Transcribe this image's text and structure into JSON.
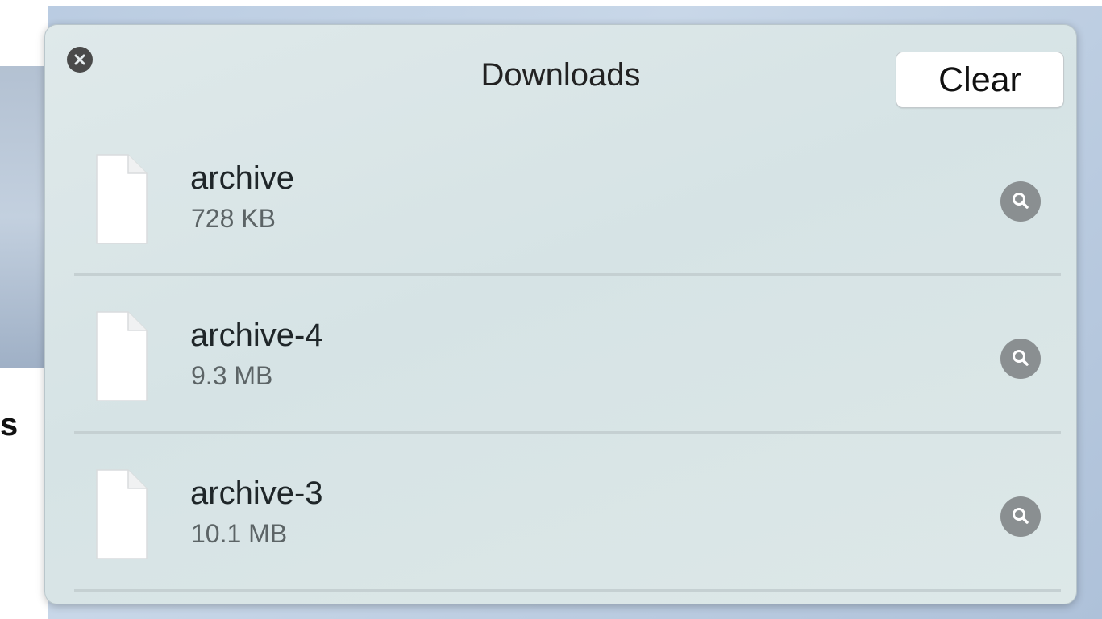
{
  "popover": {
    "title": "Downloads",
    "clear_label": "Clear"
  },
  "background": {
    "partial_letter": "s"
  },
  "downloads": [
    {
      "name": "archive",
      "size": "728 KB"
    },
    {
      "name": "archive-4",
      "size": "9.3 MB"
    },
    {
      "name": "archive-3",
      "size": "10.1 MB"
    }
  ],
  "icons": {
    "close": "close-icon",
    "file": "document-icon",
    "reveal": "magnifier-icon"
  },
  "colors": {
    "popover_bg": "#dbe6e7",
    "icon_gray": "#8a8f91",
    "close_bg": "#4a4a4a"
  }
}
